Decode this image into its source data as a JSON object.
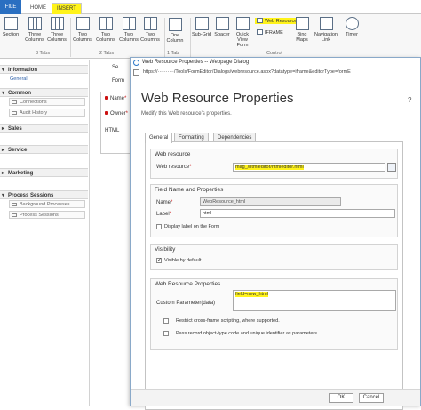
{
  "ribbon": {
    "tabs": {
      "file": "FILE",
      "home": "HOME",
      "insert": "INSERT"
    },
    "buttons": {
      "section": "Section",
      "three_columns": "Three Columns",
      "three_columns_b": "Three Columns",
      "two_columns": "Two Columns",
      "two_columns_b": "Two Columns",
      "two_columns_c": "Two Columns",
      "two_columns_d": "Two Columns",
      "one_column": "One Column",
      "sub_grid": "Sub-Grid",
      "spacer": "Spacer",
      "quick_view_form": "Quick View Form",
      "web_resource": "Web Resource",
      "iframe": "IFRAME",
      "bing_maps": "Bing Maps",
      "navigation_link": "Navigation Link",
      "timer": "Timer"
    },
    "groups": {
      "three_tabs": "3 Tabs",
      "two_tabs": "2 Tabs",
      "one_tab": "1 Tab",
      "control": "Control"
    }
  },
  "nav": {
    "information": "Information",
    "general": "General",
    "common": "Common",
    "connections": "Connections",
    "audit_history": "Audit History",
    "sales": "Sales",
    "service": "Service",
    "marketing": "Marketing",
    "process_sessions": "Process Sessions",
    "background_processes": "Background Processes",
    "process_sessions_item": "Process Sessions"
  },
  "form": {
    "section_cut": "Se",
    "form_cut": "Form",
    "name_label": "Name",
    "owner_label": "Owner",
    "html_label": "HTML"
  },
  "dialog": {
    "window_title": "Web Resource Properties -- Webpage Dialog",
    "url": "https://··········/Tools/FormEditor/Dialogs/webresource.aspx?datatype=iframe&editorType=formE",
    "heading": "Web Resource Properties",
    "subheading": "Modify this Web resource's properties.",
    "help": "?",
    "tabs": [
      "General",
      "Formatting",
      "Dependencies"
    ],
    "web_resource": {
      "section_title": "Web resource",
      "label": "Web resource",
      "value": "mag_/htmleditor/htmleditor.html"
    },
    "field_name": {
      "section_title": "Field Name and Properties",
      "name_label": "Name",
      "name_value": "WebResource_html",
      "label_label": "Label",
      "label_value": "html",
      "display_label": "Display label on the Form"
    },
    "visibility": {
      "section_title": "Visibility",
      "visible_label": "Visible by default"
    },
    "web_resource_props": {
      "section_title": "Web Resource Properties",
      "param_label": "Custom Parameter(data)",
      "param_value": "field=new_html",
      "restrict_label": "Restrict cross-frame scripting, where supported.",
      "pass_label": "Pass record object-type code and unique identifier as parameters."
    },
    "ok": "OK",
    "cancel": "Cancel"
  }
}
